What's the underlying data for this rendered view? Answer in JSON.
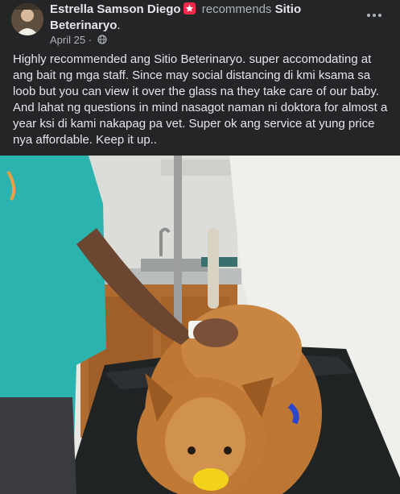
{
  "post": {
    "author": "Estrella Samson Diego",
    "recommends_word": "recommends",
    "page_name": "Sitio Beterinaryo",
    "name_end": ".",
    "date": "April 25",
    "separator": "·",
    "privacy_icon": "globe-icon",
    "more_icon": "more-options-icon",
    "badge_icon": "recommendation-badge-icon",
    "text": "Highly recommended ang Sitio Beterinaryo. super accomodating at ang bait ng mga staff. Since may social distancing di kmi ksama sa loob but you can view it over the glass na they take care of our baby. And lahat ng questions in mind nasagot naman ni doktora for almost a year ksi di kami nakapag pa vet. Super ok ang service at yung price nya affordable. Keep it up.."
  },
  "colors": {
    "background": "#242526",
    "primary_text": "#e4e6eb",
    "secondary_text": "#b0b3b8",
    "badge": "#f02849"
  }
}
